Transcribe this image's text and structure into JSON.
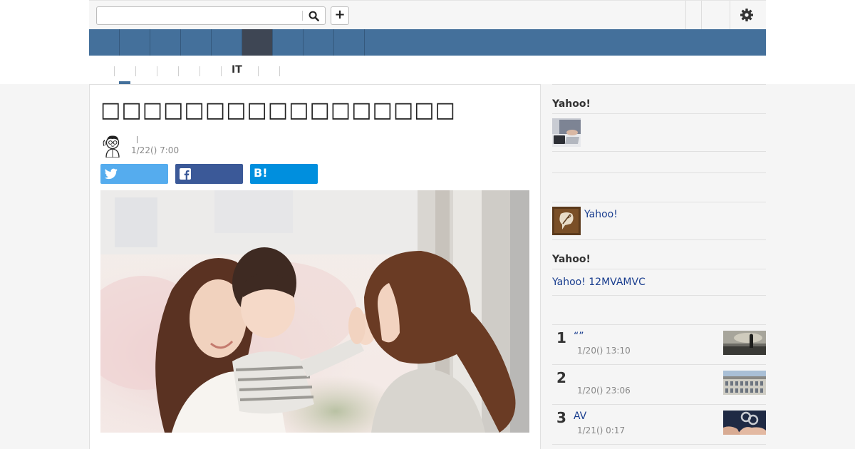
{
  "toolbar": {
    "search_placeholder": "",
    "search_icon": "search-icon",
    "plus_label": "+",
    "settings_icon": "gear-icon"
  },
  "nav": {
    "active_index": 5,
    "items": [
      "",
      "",
      "",
      "",
      "",
      "",
      "",
      "",
      ""
    ]
  },
  "subtabs": {
    "active_index": 0,
    "items": [
      "",
      "",
      "",
      "",
      "",
      "IT",
      ""
    ]
  },
  "article": {
    "headline": "□□□□□□□□□□□□□□□□□",
    "author_name": "",
    "date": "1/22() 7:00",
    "share": {
      "twitter": "",
      "facebook": "",
      "hatena": "B!"
    }
  },
  "sidebar": {
    "section1": {
      "heading": "Yahoo!",
      "item1_title": "",
      "item2_title": "",
      "item3_title": "Yahoo!"
    },
    "section2": {
      "heading": "Yahoo!",
      "link": "Yahoo! 12MVAMVC"
    },
    "ranking": [
      {
        "rank": "1",
        "title": "“”",
        "date": "1/20() 13:10"
      },
      {
        "rank": "2",
        "title": "",
        "date": "1/20() 23:06"
      },
      {
        "rank": "3",
        "title": "AV",
        "date": "1/21() 0:17"
      }
    ]
  },
  "colors": {
    "nav_bg": "#44709b",
    "nav_active": "#3e4654",
    "twitter": "#55acee",
    "facebook": "#3b5998",
    "hatena": "#008fde",
    "link": "#1a3e8f"
  }
}
